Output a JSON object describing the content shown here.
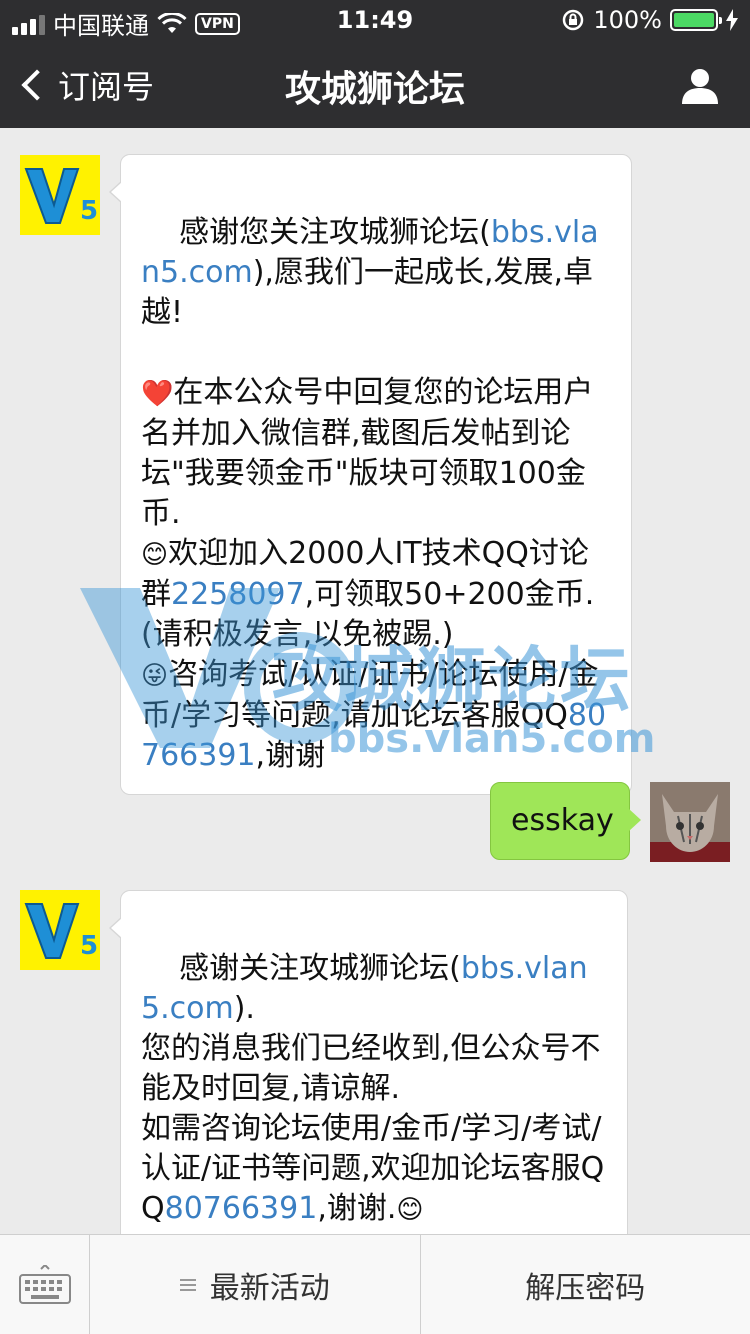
{
  "status": {
    "carrier": "中国联通",
    "vpn": "VPN",
    "time": "11:49",
    "battery": "100%",
    "battery_level": 1.0
  },
  "nav": {
    "back_label": "订阅号",
    "title": "攻城狮论坛",
    "person_icon": "person-icon"
  },
  "messages": [
    {
      "from": "bot",
      "avatar": "V5",
      "p1a": "感谢您关注攻城狮论坛(",
      "p1link": "bbs.vlan5.com",
      "p1b": "),愿我们一起成长,发展,卓越!",
      "p2": "在本公众号中回复您的论坛用户名并加入微信群,截图后发帖到论坛\"我要领金币\"版块可领取100金币.",
      "p3a": "欢迎加入2000人IT技术QQ讨论群",
      "p3link": "2258097",
      "p3b": ",可领取50+200金币.(请积极发言,以免被踢.)",
      "p4a": "咨询考试/认证/证书/论坛使用/金币/学习等问题,请加论坛客服QQ",
      "p4link": "80766391",
      "p4b": ",谢谢"
    },
    {
      "from": "me",
      "text": "esskay"
    },
    {
      "from": "bot",
      "avatar": "V5",
      "p1a": "感谢关注攻城狮论坛(",
      "p1link": "bbs.vlan5.com",
      "p1b": ").",
      "p2": "您的消息我们已经收到,但公众号不能及时回复,请谅解.",
      "p3a": "如需咨询论坛使用/金币/学习/考试/认证/证书等问题,欢迎加论坛客服QQ",
      "p3link": "80766391",
      "p3b": ",谢谢."
    }
  ],
  "watermark": {
    "title": "攻城狮论坛",
    "url": "bbs.vlan5.com"
  },
  "bottom_menu": {
    "item1": "最新活动",
    "item2": "解压密码"
  }
}
